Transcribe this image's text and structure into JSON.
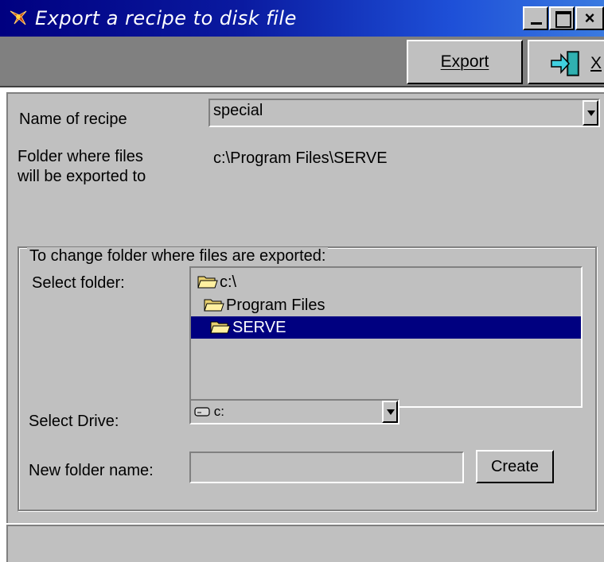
{
  "window": {
    "title": "Export a recipe to disk file"
  },
  "toolbar": {
    "export_label": "Export",
    "exit_label": "X"
  },
  "form": {
    "recipe_label": "Name of recipe",
    "recipe_value": "special",
    "folder_label_line1": "Folder where files",
    "folder_label_line2": "will be exported to",
    "folder_path": "c:\\Program Files\\SERVE"
  },
  "change_folder": {
    "group_title": "To change folder where files are exported:",
    "select_folder_label": "Select folder:",
    "folders": [
      {
        "name": "c:\\",
        "selected": false
      },
      {
        "name": "Program Files",
        "selected": false
      },
      {
        "name": "SERVE",
        "selected": true
      }
    ],
    "select_drive_label": "Select Drive:",
    "drive_value": "c:",
    "new_folder_label": "New folder name:",
    "new_folder_value": "",
    "create_label": "Create"
  },
  "colors": {
    "title_bar": "#000080",
    "selection": "#000080",
    "face": "#c0c0c0",
    "toolbar": "#808080"
  },
  "icons": [
    "app-icon",
    "minimize-icon",
    "maximize-icon",
    "close-icon",
    "exit-door-icon",
    "folder-open-icon",
    "drive-icon",
    "chevron-down-icon"
  ]
}
